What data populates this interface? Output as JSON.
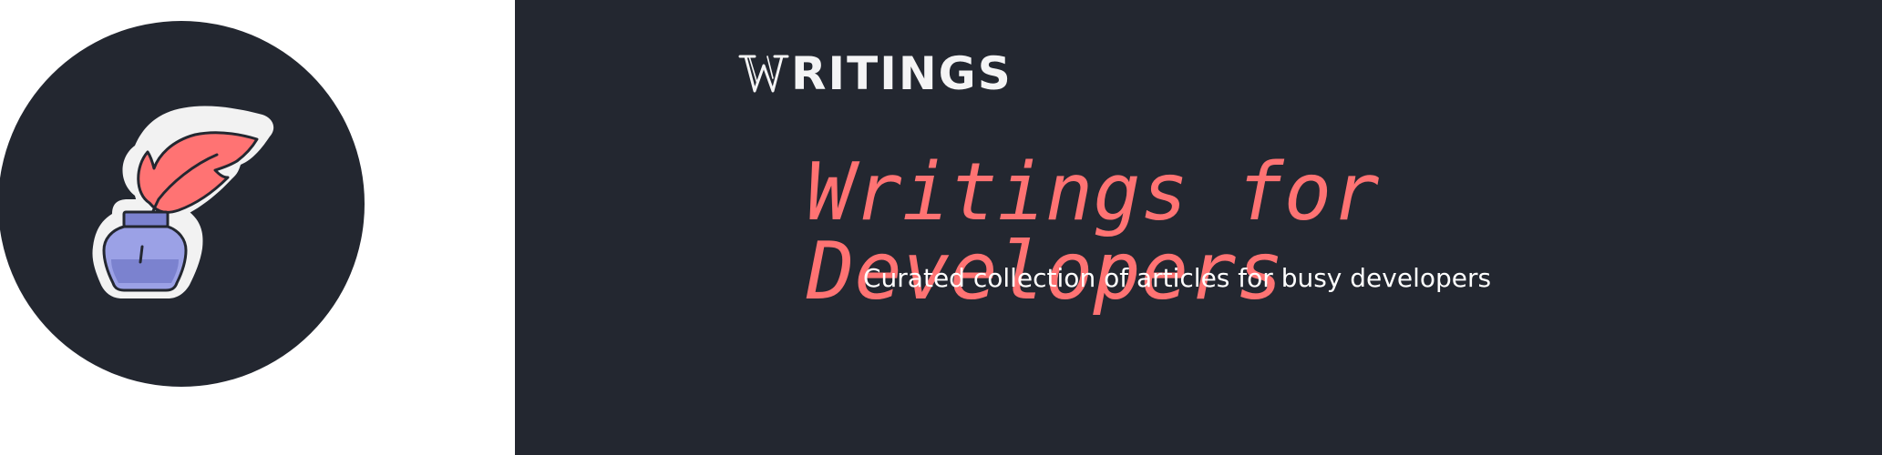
{
  "logo": {
    "icon": "quill-and-inkwell-icon"
  },
  "brand": {
    "initial_icon": "serif-w-icon",
    "text": "RITINGS"
  },
  "hero": {
    "headline": "Writings for Developers",
    "tagline": "Curated collection of articles for busy developers"
  },
  "colors": {
    "background_dark": "#232730",
    "accent_red": "#ff7373",
    "ink_blue": "#7b82cf",
    "white": "#ffffff"
  }
}
